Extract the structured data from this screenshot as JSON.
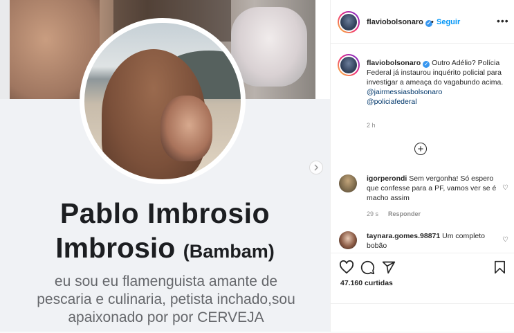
{
  "media": {
    "name_line1": "Pablo Imbrosio",
    "name_line2": "Imbrosio",
    "nickname": "(Bambam)",
    "bio_lines": [
      "eu sou eu flamenguista amante de",
      "pescaria e culinaria, petista inchado,sou",
      "apaixonado por por CERVEJA"
    ],
    "next_icon": "chevron-right-icon"
  },
  "header": {
    "username": "flaviobolsonaro",
    "separator": "•",
    "follow_label": "Seguir",
    "more_icon": "more-options-icon"
  },
  "caption": {
    "username": "flaviobolsonaro",
    "text": "Outro Adélio? Polícia Federal já instaurou inquérito policial para investigar a ameaça do vagabundo acima.",
    "mentions": [
      "@jairmessiasbolsonaro",
      "@policiafederal"
    ],
    "time": "2 h"
  },
  "comments": [
    {
      "username": "igorperondi",
      "text": "Sem vergonha! Só espero que confesse para a PF, vamos ver se é macho assim",
      "time": "29 s",
      "reply_label": "Responder"
    },
    {
      "username": "taynara.gomes.98871",
      "text": "Um completo bobão"
    }
  ],
  "actions": {
    "likes": "47.160 curtidas"
  },
  "colors": {
    "accent": "#0095f6",
    "verified": "#3897f0",
    "mention": "#00376b",
    "muted": "#8e8e8e"
  }
}
